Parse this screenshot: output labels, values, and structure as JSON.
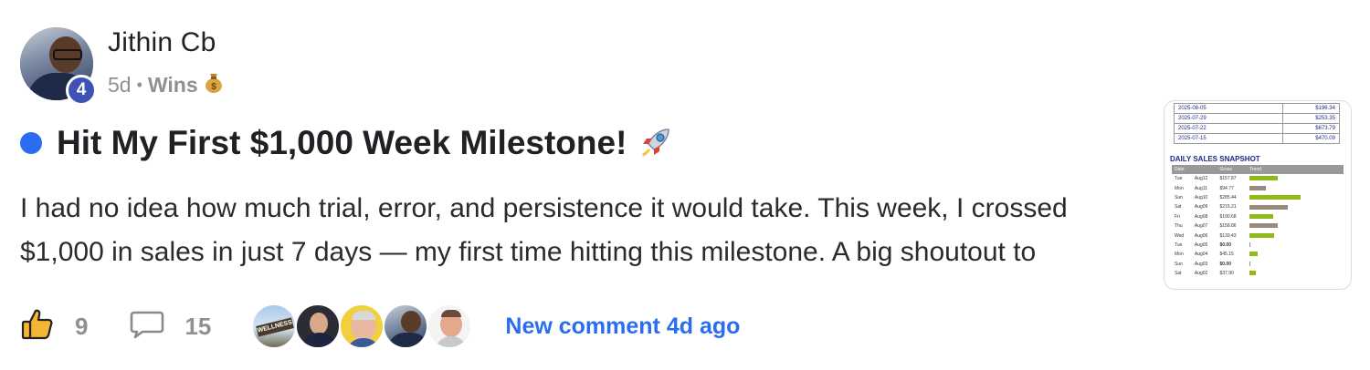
{
  "post": {
    "author": "Jithin Cb",
    "level": "4",
    "age": "5d",
    "separator": "•",
    "category": "Wins",
    "category_icon": "money-bag-icon",
    "title": "Hit My First $1,000 Week Milestone!",
    "title_icon": "rocket-icon",
    "body_lines": [
      "I had no idea how much trial, error, and persistence it would take. This week, I crossed",
      "$1,000 in sales in just 7 days — my first time hitting this milestone. A big shoutout to"
    ],
    "unread_color": "#2a6df0"
  },
  "attachment": {
    "top_rows": [
      {
        "date": "2025-08-05",
        "value": "$196.34"
      },
      {
        "date": "2025-07-29",
        "value": "$253.35"
      },
      {
        "date": "2025-07-22",
        "value": "$673.79"
      },
      {
        "date": "2025-07-15",
        "value": "$470.09"
      }
    ],
    "snapshot_title": "DAILY SALES SNAPSHOT",
    "columns": [
      "Date",
      "Gross",
      "Trend"
    ],
    "rows": [
      {
        "day": "Tue",
        "date": "Aug12",
        "gross": "$157.87",
        "trend": 0.55,
        "color": "#8fba1a"
      },
      {
        "day": "Mon",
        "date": "Aug11",
        "gross": "$94.77",
        "trend": 0.33,
        "color": "#9a8a7e"
      },
      {
        "day": "Sun",
        "date": "Aug10",
        "gross": "$285.44",
        "trend": 1.0,
        "color": "#8fba1a"
      },
      {
        "day": "Sat",
        "date": "Aug09",
        "gross": "$215.21",
        "trend": 0.75,
        "color": "#9a8a7e"
      },
      {
        "day": "Fri",
        "date": "Aug08",
        "gross": "$190.68",
        "trend": 0.46,
        "color": "#8fba1a"
      },
      {
        "day": "Thu",
        "date": "Aug07",
        "gross": "$158.86",
        "trend": 0.55,
        "color": "#9a8a7e"
      },
      {
        "day": "Wed",
        "date": "Aug06",
        "gross": "$139.43",
        "trend": 0.49,
        "color": "#8fba1a"
      },
      {
        "day": "Tue",
        "date": "Aug05",
        "gross": "$0.00",
        "trend": 0.02,
        "color": "#9a8a7e"
      },
      {
        "day": "Mon",
        "date": "Aug04",
        "gross": "$45.15",
        "trend": 0.16,
        "color": "#8fba1a"
      },
      {
        "day": "Sun",
        "date": "Aug03",
        "gross": "$0.00",
        "trend": 0.02,
        "color": "#9a8a7e"
      },
      {
        "day": "Sat",
        "date": "Aug02",
        "gross": "$37.90",
        "trend": 0.13,
        "color": "#8fba1a"
      }
    ]
  },
  "footer": {
    "like_icon": "thumbs-up-icon",
    "like_count": "9",
    "comment_icon": "comment-icon",
    "comment_count": "15",
    "wellness_label": "WELLNESS",
    "new_comment": "New comment 4d ago",
    "link_color": "#2a6df0"
  }
}
